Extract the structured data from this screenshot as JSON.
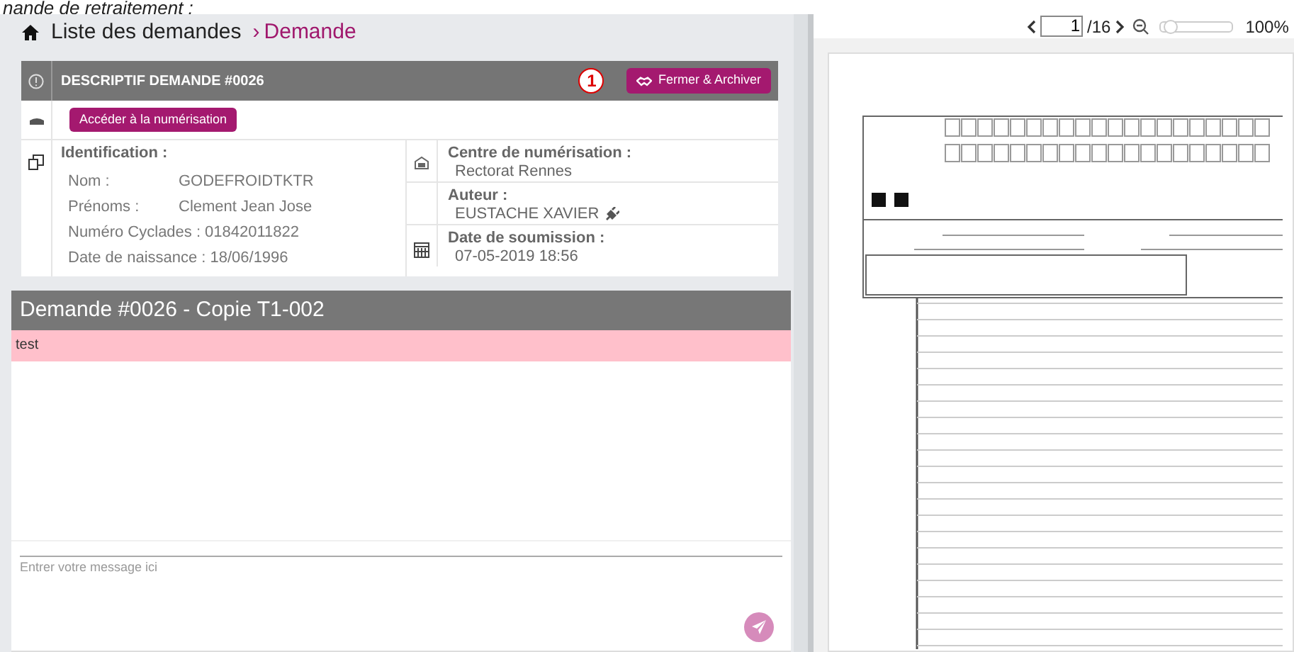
{
  "caption": "nande de retraitement :",
  "breadcrumb": {
    "home": "Liste des demandes",
    "separator": "›",
    "current": "Demande"
  },
  "card": {
    "title": "DESCRIPTIF DEMANDE #0026",
    "annotation": "1",
    "close_button": "Fermer & Archiver",
    "scan_button": "Accéder à la numérisation",
    "identification": {
      "heading": "Identification :",
      "fields": [
        {
          "label": "Nom :",
          "value": "GODEFROIDTKTR"
        },
        {
          "label": "Prénoms :",
          "value": "Clement Jean Jose"
        },
        {
          "label": "Numéro Cyclades :",
          "value": "01842011822"
        },
        {
          "label": "Date de naissance :",
          "value": "18/06/1996"
        }
      ]
    },
    "details": [
      {
        "kind": "center",
        "heading": "Centre de numérisation :",
        "value": "Rectorat Rennes"
      },
      {
        "kind": "author",
        "heading": "Auteur :",
        "value": "EUSTACHE XAVIER"
      },
      {
        "kind": "date",
        "heading": "Date de soumission :",
        "value": "07-05-2019 18:56"
      }
    ]
  },
  "chat": {
    "title": "Demande #0026 - Copie T1-002",
    "messages": [
      {
        "text": "test"
      }
    ],
    "placeholder": "Entrer votre message ici"
  },
  "viewer": {
    "page": "1",
    "total": "/16",
    "zoom": {
      "level": 0.05
    },
    "zoom_reading": "100%"
  }
}
